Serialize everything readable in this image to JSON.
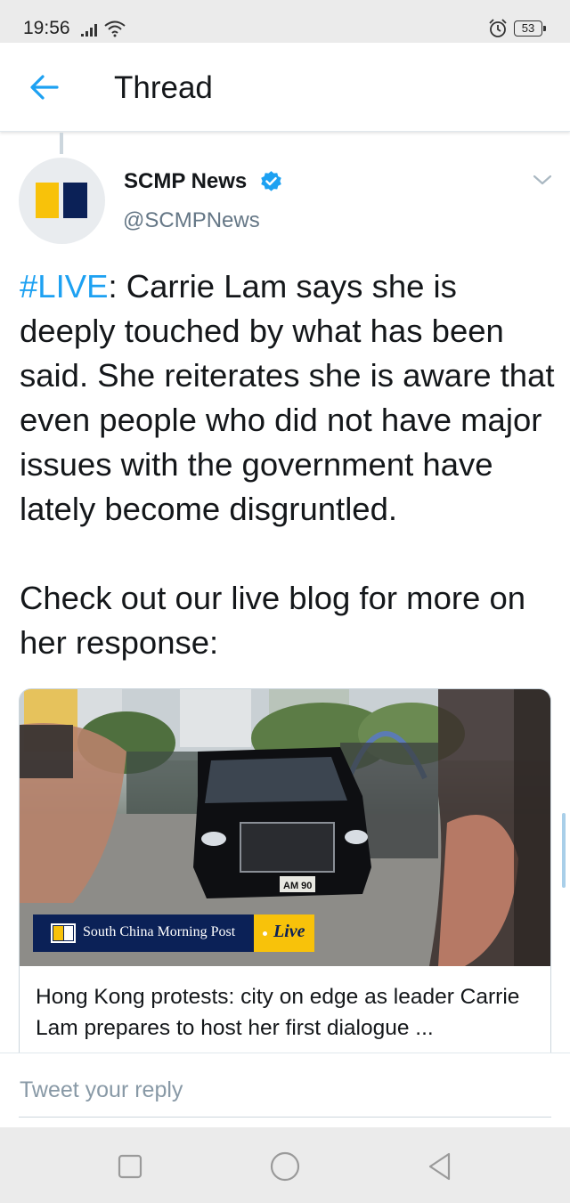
{
  "status_bar": {
    "time": "19:56",
    "battery": "53",
    "icons": [
      "signal-icon",
      "wifi-icon",
      "alarm-icon",
      "battery-icon"
    ]
  },
  "header": {
    "title": "Thread",
    "back_icon": "arrow-left-icon",
    "accent_color": "#1da1f2"
  },
  "tweet": {
    "author_name": "SCMP News",
    "handle": "@SCMPNews",
    "verified": true,
    "hashtag": "#LIVE",
    "text_after_hashtag": ": Carrie Lam says she is deeply touched by what has been said. She reiterates she is aware that even people who did not have major issues with the government have lately become disgruntled.",
    "text_paragraph_2": "Check out our live blog for more on her response:",
    "card": {
      "brand": "South China Morning Post",
      "live_label": "Live",
      "plate_text": "AM 90",
      "title": "Hong Kong protests: city on edge as leader Carrie Lam prepares to host her first dialogue ..."
    }
  },
  "reply": {
    "placeholder": "Tweet your reply"
  },
  "nav_bar": {
    "buttons": [
      "recents-square-icon",
      "home-circle-icon",
      "back-triangle-icon"
    ]
  },
  "colors": {
    "brand_yellow": "#f8c20a",
    "brand_navy": "#0b2157",
    "verified_blue": "#1da1f2"
  }
}
